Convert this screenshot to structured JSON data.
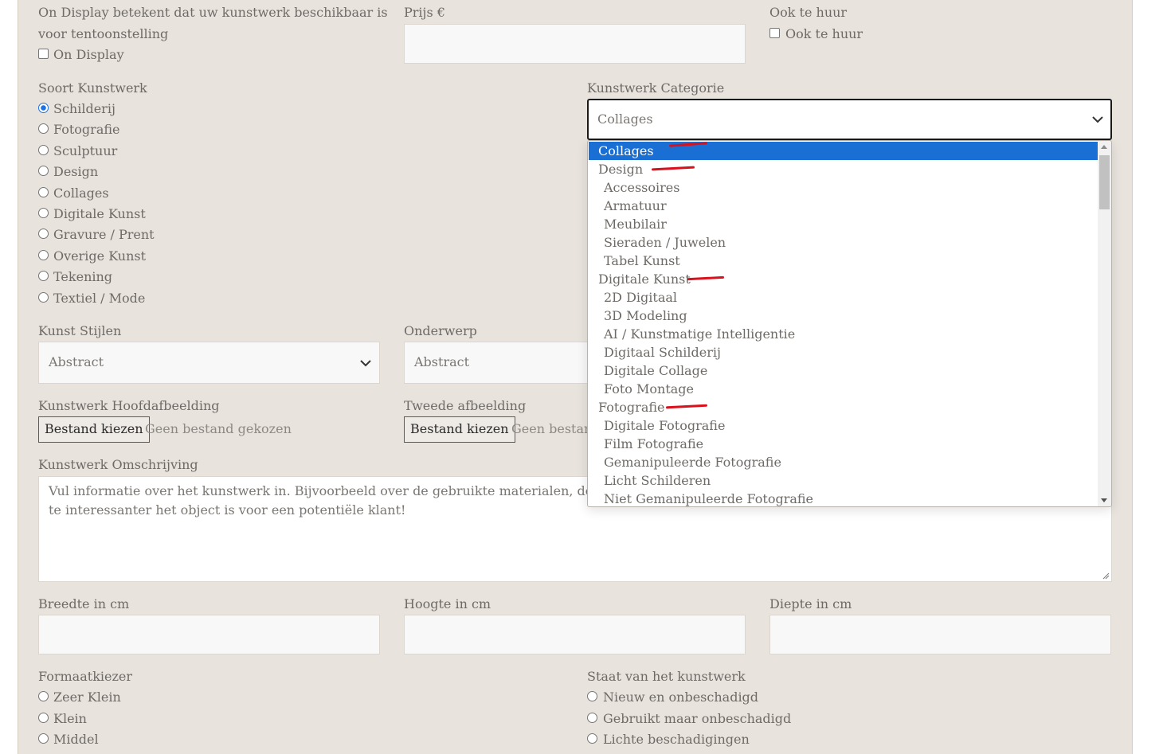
{
  "display": {
    "help_text_line1": "On Display betekent dat uw kunstwerk beschikbaar is",
    "help_text_line2": "voor tentoonstelling",
    "checkbox_label": "On Display"
  },
  "price": {
    "label": "Prijs €",
    "value": ""
  },
  "rent": {
    "label": "Ook te huur",
    "checkbox_label": "Ook te huur"
  },
  "artwork_type": {
    "label": "Soort Kunstwerk",
    "options": [
      "Schilderij",
      "Fotografie",
      "Sculptuur",
      "Design",
      "Collages",
      "Digitale Kunst",
      "Gravure / Prent",
      "Overige Kunst",
      "Tekening",
      "Textiel / Mode"
    ],
    "selected": "Schilderij"
  },
  "category": {
    "label": "Kunstwerk Categorie",
    "value": "Collages",
    "options": [
      {
        "label": "Collages",
        "level": 0,
        "selected": true
      },
      {
        "label": "Design",
        "level": 0
      },
      {
        "label": "Accessoires",
        "level": 1
      },
      {
        "label": "Armatuur",
        "level": 1
      },
      {
        "label": "Meubilair",
        "level": 1
      },
      {
        "label": "Sieraden / Juwelen",
        "level": 1
      },
      {
        "label": "Tabel Kunst",
        "level": 1
      },
      {
        "label": "Digitale Kunst",
        "level": 0
      },
      {
        "label": "2D Digitaal",
        "level": 1
      },
      {
        "label": "3D Modeling",
        "level": 1
      },
      {
        "label": "AI / Kunstmatige Intelligentie",
        "level": 1
      },
      {
        "label": "Digitaal Schilderij",
        "level": 1
      },
      {
        "label": "Digitale Collage",
        "level": 1
      },
      {
        "label": "Foto Montage",
        "level": 1
      },
      {
        "label": "Fotografie",
        "level": 0
      },
      {
        "label": "Digitale Fotografie",
        "level": 1
      },
      {
        "label": "Film Fotografie",
        "level": 1
      },
      {
        "label": "Gemanipuleerde Fotografie",
        "level": 1
      },
      {
        "label": "Licht Schilderen",
        "level": 1
      },
      {
        "label": "Niet Gemanipuleerde Fotografie",
        "level": 1
      }
    ]
  },
  "styles": {
    "label": "Kunst Stijlen",
    "value": "Abstract"
  },
  "subject": {
    "label": "Onderwerp",
    "value": "Abstract"
  },
  "main_image": {
    "label": "Kunstwerk Hoofdafbeelding",
    "button": "Bestand kiezen",
    "status": "Geen bestand gekozen"
  },
  "second_image": {
    "label": "Tweede afbeelding",
    "button": "Bestand kiezen",
    "status": "Geen bestand"
  },
  "description": {
    "label": "Kunstwerk Omschrijving",
    "placeholder_line1": "Vul informatie over het kunstwerk in. Bijvoorbeeld over de gebruikte materialen, de peri",
    "placeholder_line2": "te interessanter het object is voor een potentiële klant!"
  },
  "width": {
    "label": "Breedte in cm"
  },
  "height": {
    "label": "Hoogte in cm"
  },
  "depth": {
    "label": "Diepte in cm"
  },
  "format": {
    "label": "Formaatkiezer",
    "options": [
      "Zeer Klein",
      "Klein",
      "Middel"
    ]
  },
  "condition": {
    "label": "Staat van het kunstwerk",
    "options": [
      "Nieuw en onbeschadigd",
      "Gebruikt maar onbeschadigd",
      "Lichte beschadigingen"
    ]
  },
  "colors": {
    "accent": "#1a6fd4",
    "panel": "#e9e3dd",
    "annotation": "#d9111c"
  }
}
